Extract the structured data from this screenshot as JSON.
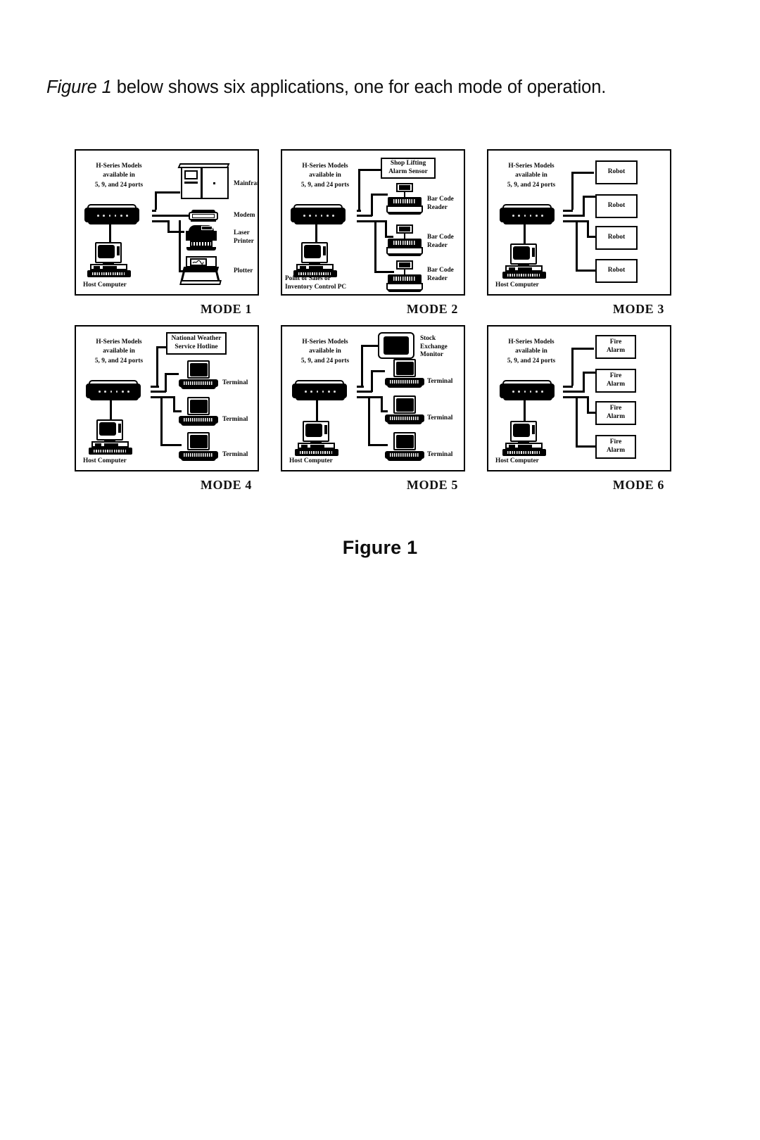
{
  "document": {
    "intro_italic": "Figure 1",
    "intro_rest": " below shows six applications, one for each mode of operation.",
    "figure_caption": "Figure 1"
  },
  "common": {
    "hseries_line1": "H-Series Models",
    "hseries_line2": "available in",
    "hseries_line3": "5, 9, and 24 ports",
    "host_computer": "Host Computer"
  },
  "modes": [
    {
      "id": "mode-1",
      "label": "MODE 1",
      "host_label": "Host Computer",
      "host_label_2": "",
      "devices": [
        {
          "name": "mainframe",
          "label": "Mainframe"
        },
        {
          "name": "modem",
          "label": "Modem"
        },
        {
          "name": "laser-printer",
          "label_line1": "Laser",
          "label_line2": "Printer"
        },
        {
          "name": "plotter",
          "label": "Plotter"
        }
      ]
    },
    {
      "id": "mode-2",
      "label": "MODE 2",
      "host_label": "Point of Sales or",
      "host_label_2": "Inventory Control PC",
      "devices": [
        {
          "name": "shop-lifting-alarm-sensor",
          "label_line1": "Shop Lifting",
          "label_line2": "Alarm Sensor"
        },
        {
          "name": "bar-code-reader-1",
          "label_line1": "Bar Code",
          "label_line2": "Reader"
        },
        {
          "name": "bar-code-reader-2",
          "label_line1": "Bar Code",
          "label_line2": "Reader"
        },
        {
          "name": "bar-code-reader-3",
          "label_line1": "Bar Code",
          "label_line2": "Reader"
        }
      ]
    },
    {
      "id": "mode-3",
      "label": "MODE 3",
      "host_label": "Host Computer",
      "host_label_2": "",
      "devices": [
        {
          "name": "robot-1",
          "label": "Robot"
        },
        {
          "name": "robot-2",
          "label": "Robot"
        },
        {
          "name": "robot-3",
          "label": "Robot"
        },
        {
          "name": "robot-4",
          "label": "Robot"
        }
      ]
    },
    {
      "id": "mode-4",
      "label": "MODE 4",
      "host_label": "Host Computer",
      "host_label_2": "",
      "devices": [
        {
          "name": "national-weather-service-hotline",
          "label_line1": "National Weather",
          "label_line2": "Service Hotline"
        },
        {
          "name": "terminal-1",
          "label": "Terminal"
        },
        {
          "name": "terminal-2",
          "label": "Terminal"
        },
        {
          "name": "terminal-3",
          "label": "Terminal"
        }
      ]
    },
    {
      "id": "mode-5",
      "label": "MODE 5",
      "host_label": "Host Computer",
      "host_label_2": "",
      "devices": [
        {
          "name": "stock-exchange-monitor",
          "label_line1": "Stock",
          "label_line2": "Exchange",
          "label_line3": "Monitor"
        },
        {
          "name": "terminal-1",
          "label": "Terminal"
        },
        {
          "name": "terminal-2",
          "label": "Terminal"
        },
        {
          "name": "terminal-3",
          "label": "Terminal"
        }
      ]
    },
    {
      "id": "mode-6",
      "label": "MODE 6",
      "host_label": "Host Computer",
      "host_label_2": "",
      "devices": [
        {
          "name": "fire-alarm-1",
          "label_line1": "Fire",
          "label_line2": "Alarm"
        },
        {
          "name": "fire-alarm-2",
          "label_line1": "Fire",
          "label_line2": "Alarm"
        },
        {
          "name": "fire-alarm-3",
          "label_line1": "Fire",
          "label_line2": "Alarm"
        },
        {
          "name": "fire-alarm-4",
          "label_line1": "Fire",
          "label_line2": "Alarm"
        }
      ]
    }
  ],
  "colors": {
    "ink": "#000000",
    "page": "#ffffff"
  }
}
